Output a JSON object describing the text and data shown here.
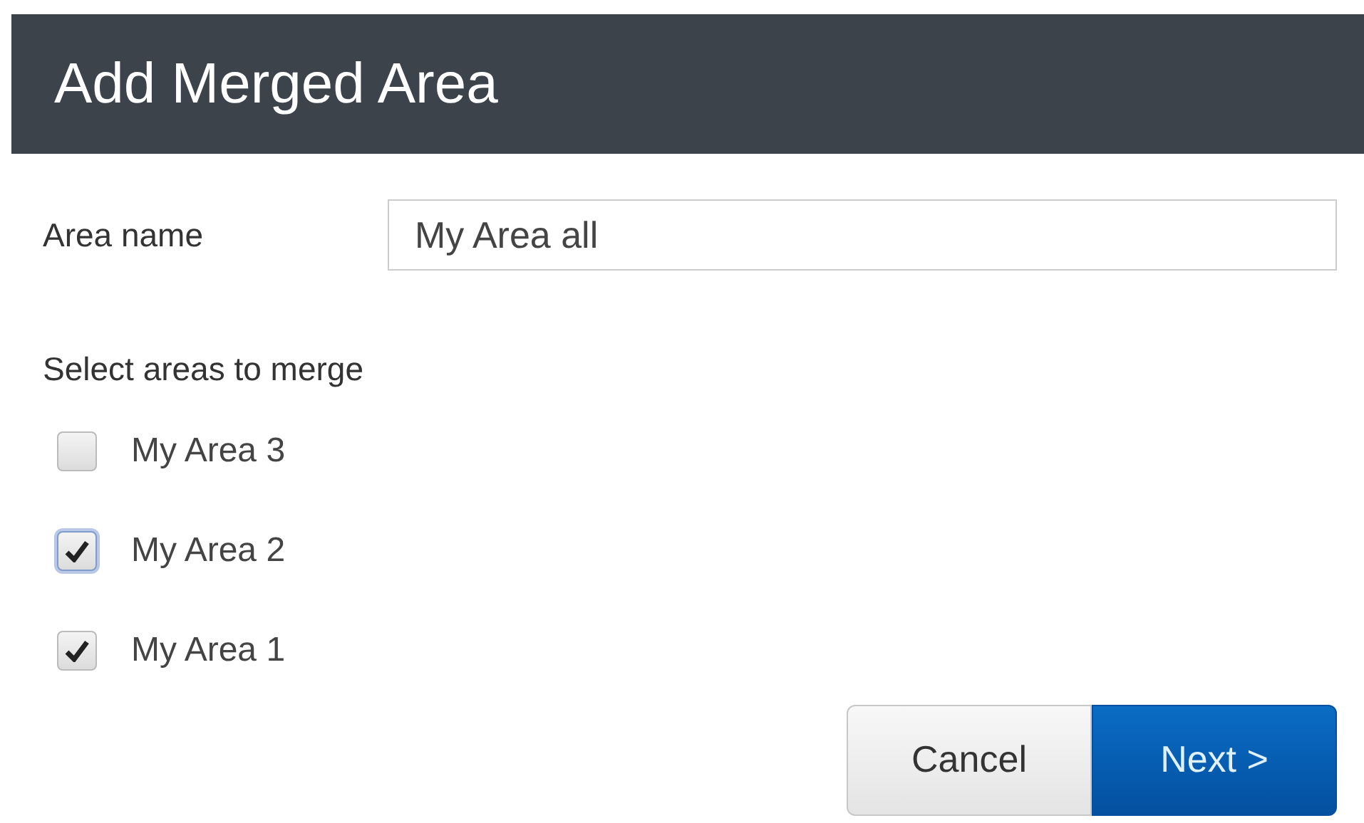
{
  "dialog": {
    "title": "Add Merged Area"
  },
  "area_name": {
    "label": "Area name",
    "value": "My Area all"
  },
  "areas": {
    "heading": "Select areas to merge",
    "items": [
      {
        "label": "My Area 3",
        "checked": false,
        "focused": false
      },
      {
        "label": "My Area 2",
        "checked": true,
        "focused": true
      },
      {
        "label": "My Area 1",
        "checked": true,
        "focused": false
      }
    ]
  },
  "buttons": [
    {
      "label": "Cancel",
      "kind": "secondary"
    },
    {
      "label": "Next >",
      "kind": "primary"
    }
  ]
}
